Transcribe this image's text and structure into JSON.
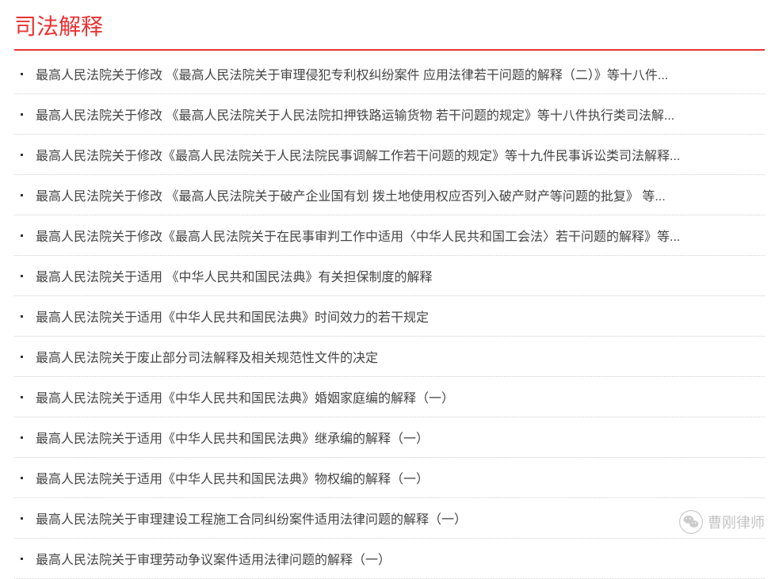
{
  "title": "司法解释",
  "items": [
    "最高人民法院关于修改 《最高人民法院关于审理侵犯专利权纠纷案件 应用法律若干问题的解释（二）》等十八件...",
    "最高人民法院关于修改 《最高人民法院关于人民法院扣押铁路运输货物 若干问题的规定》等十八件执行类司法解...",
    "最高人民法院关于修改《最高人民法院关于人民法院民事调解工作若干问题的规定》等十九件民事诉讼类司法解释...",
    "最高人民法院关于修改 《最高人民法院关于破产企业国有划 拨土地使用权应否列入破产财产等问题的批复》 等...",
    "最高人民法院关于修改《最高人民法院关于在民事审判工作中适用〈中华人民共和国工会法〉若干问题的解释》等...",
    "最高人民法院关于适用 《中华人民共和国民法典》有关担保制度的解释",
    "最高人民法院关于适用《中华人民共和国民法典》时间效力的若干规定",
    "最高人民法院关于废止部分司法解释及相关规范性文件的决定",
    "最高人民法院关于适用《中华人民共和国民法典》婚姻家庭编的解释（一）",
    "最高人民法院关于适用《中华人民共和国民法典》继承编的解释（一）",
    "最高人民法院关于适用《中华人民共和国民法典》物权编的解释（一）",
    "最高人民法院关于审理建设工程施工合同纠纷案件适用法律问题的解释（一）",
    "最高人民法院关于审理劳动争议案件适用法律问题的解释（一）"
  ],
  "wechat": {
    "name": "曹刚律师"
  }
}
